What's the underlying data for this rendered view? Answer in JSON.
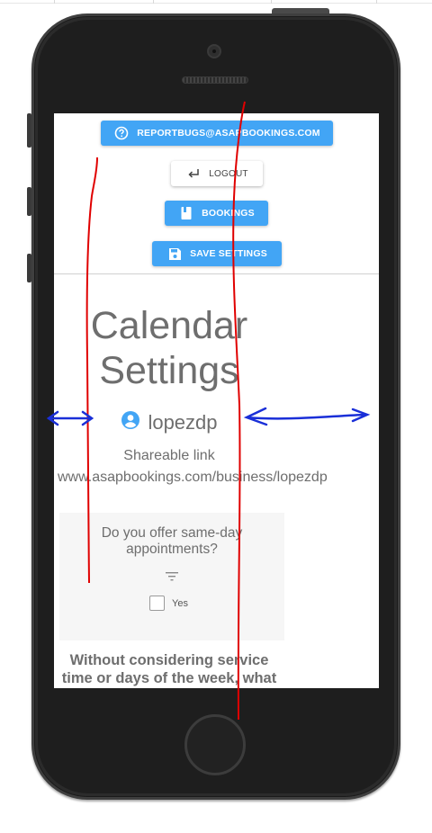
{
  "actions": {
    "report_bugs_label": "REPORTBUGS@ASAPBOOKINGS.COM",
    "logout_label": "LOGOUT",
    "bookings_label": "BOOKINGS",
    "save_settings_label": "SAVE SETTINGS"
  },
  "page": {
    "title_line1": "Calendar",
    "title_line2": "Settings",
    "username": "lopezdp",
    "share_label": "Shareable link",
    "share_url": "www.asapbookings.com/business/lopezdp"
  },
  "same_day": {
    "question_line1": "Do you offer same-day",
    "question_line2": "appointments?",
    "option_label": "Yes",
    "checked": false
  },
  "next_question": {
    "line1": "Without considering service",
    "line2": "time or days of the week, what"
  },
  "colors": {
    "button_blue": "#42a5f5",
    "annotation_red": "#e00000",
    "annotation_blue": "#1a2fd8",
    "phone_body": "#2b2b2b"
  },
  "icons": {
    "help": "help-circle-icon",
    "logout": "logout-arrow-icon",
    "bookings": "book-icon",
    "save": "floppy-disk-icon",
    "user": "account-circle-icon",
    "filter": "filter-icon"
  }
}
